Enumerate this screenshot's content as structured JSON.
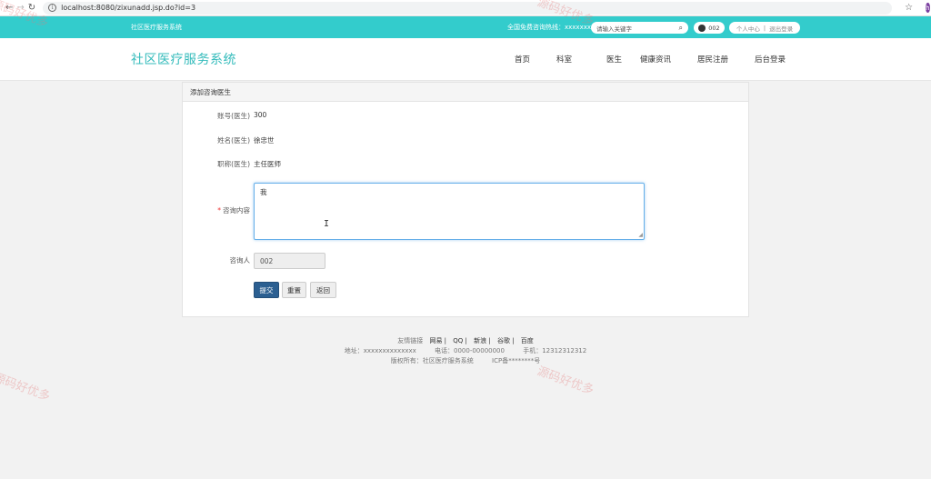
{
  "browser": {
    "url": "localhost:8080/zixunadd.jsp.do?id=3",
    "profile_initial": "h"
  },
  "topbar": {
    "site_name": "社区医疗服务系统",
    "hotline": "全国免费咨询热线：xxxxxxx",
    "search_placeholder": "请输入关键字",
    "user": "002",
    "personal_center": "个人中心",
    "divider": "|",
    "logout": "退出登录"
  },
  "header": {
    "logo": "社区医疗服务系统",
    "nav": [
      "首页",
      "科室",
      "医生",
      "健康资讯",
      "居民注册",
      "后台登录"
    ]
  },
  "form": {
    "title": "添加咨询医生",
    "account_label": "账号(医生)",
    "account_value": "300",
    "name_label": "姓名(医生)",
    "name_value": "徐忠世",
    "position_label": "职称(医生)",
    "position_value": "主任医师",
    "content_label": "咨询内容",
    "required_mark": "*",
    "content_value": "我",
    "consultant_label": "咨询人",
    "consultant_value": "002",
    "submit": "提交",
    "reset": "重置",
    "back": "返回"
  },
  "footer": {
    "friends_label": "友情链接",
    "friends": [
      "网易 |",
      "QQ |",
      "新浪 |",
      "谷歌 |",
      "百度"
    ],
    "address": "地址：xxxxxxxxxxxxxx",
    "phone": "电话：0000-00000000",
    "mobile": "手机：12312312312",
    "copyright": "版权所有：社区医疗服务系统",
    "icp": "ICP备********号"
  },
  "watermark": "源码好优多",
  "colors": {
    "accent": "#33cccc",
    "primary_button": "#2b5f91"
  }
}
